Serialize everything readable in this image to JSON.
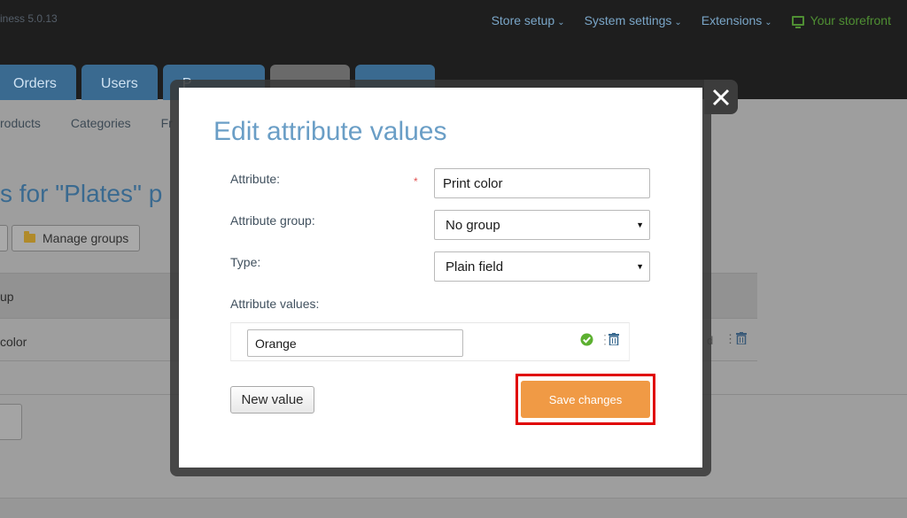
{
  "app": {
    "version": "iness 5.0.13"
  },
  "topnav": {
    "items": [
      {
        "label": "Store setup"
      },
      {
        "label": "System settings"
      },
      {
        "label": "Extensions"
      }
    ],
    "storefront": "Your storefront",
    "caret": "⌄"
  },
  "tabs": [
    {
      "label": "Orders"
    },
    {
      "label": "Users"
    },
    {
      "label": "P"
    }
  ],
  "subnav": [
    {
      "label": "roducts"
    },
    {
      "label": "Categories"
    },
    {
      "label": "Fr"
    }
  ],
  "page": {
    "title": "s for \"Plates\" p",
    "manage_groups": "Manage groups",
    "table_header": "up",
    "row_cell": "color",
    "row_cell_right": "d"
  },
  "modal": {
    "title": "Edit attribute values",
    "attribute_label": "Attribute:",
    "required_mark": "*",
    "attribute_value": "Print color",
    "group_label": "Attribute group:",
    "group_value": "No group",
    "type_label": "Type:",
    "type_value": "Plain field",
    "values_label": "Attribute values:",
    "values": [
      {
        "value": "Orange"
      }
    ],
    "new_value_button": "New value",
    "save_button": "Save changes"
  },
  "colors": {
    "accent_title": "#6a9ec6",
    "save_button": "#f09a45",
    "highlight": "#e00000",
    "ok_icon": "#5cb030",
    "trash_icon": "#3a6a90"
  }
}
